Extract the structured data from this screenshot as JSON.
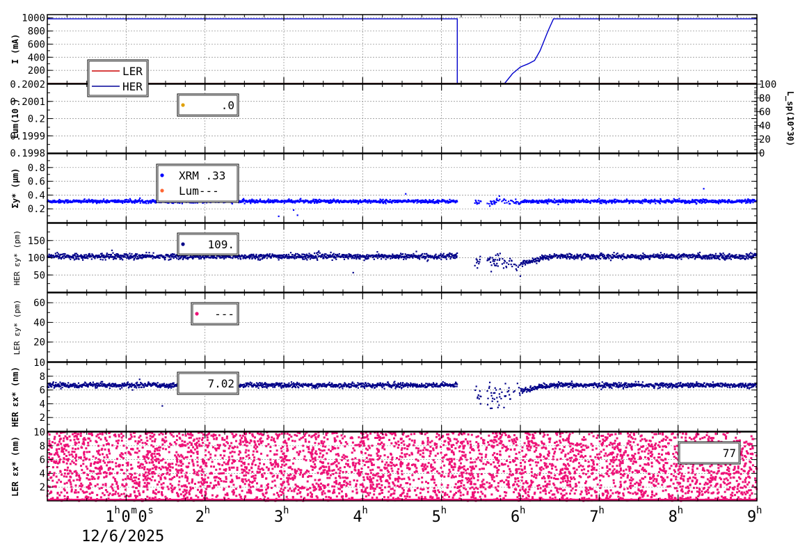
{
  "chart_data": {
    "type": "scatter",
    "x_axis": {
      "unit": "hours",
      "range": [
        0.0,
        9.0
      ],
      "tick_labels": [
        {
          "value": 1,
          "text": "1",
          "sup": "h",
          "extra": "0",
          "extra_sup": "m",
          "extra2": "0",
          "extra2_sup": "s"
        },
        {
          "value": 2,
          "text": "2",
          "sup": "h"
        },
        {
          "value": 3,
          "text": "3",
          "sup": "h"
        },
        {
          "value": 4,
          "text": "4",
          "sup": "h"
        },
        {
          "value": 5,
          "text": "5",
          "sup": "h"
        },
        {
          "value": 6,
          "text": "6",
          "sup": "h"
        },
        {
          "value": 7,
          "text": "7",
          "sup": "h"
        },
        {
          "value": 8,
          "text": "8",
          "sup": "h"
        },
        {
          "value": 9,
          "text": "9",
          "sup": "h"
        }
      ],
      "date_label": "12/6/2025"
    },
    "panels": [
      {
        "id": "current",
        "ylabel": "I (mA)",
        "ylim": [
          0,
          1050
        ],
        "yticks": [
          200,
          400,
          600,
          800,
          1000
        ],
        "grid": true,
        "legend": [
          {
            "name": "LER",
            "color": "#cc0000",
            "type": "line"
          },
          {
            "name": "HER",
            "color": "#000099",
            "type": "line"
          }
        ],
        "series": [
          {
            "name": "HER",
            "color": "#0000cc",
            "type": "line",
            "points": [
              [
                0.0,
                985
              ],
              [
                5.2,
                985
              ],
              [
                5.2,
                0
              ],
              [
                5.8,
                0
              ],
              [
                5.9,
                150
              ],
              [
                6.0,
                250
              ],
              [
                6.1,
                300
              ],
              [
                6.18,
                350
              ],
              [
                6.25,
                500
              ],
              [
                6.35,
                800
              ],
              [
                6.42,
                985
              ],
              [
                9.0,
                985
              ]
            ]
          },
          {
            "name": "LER",
            "color": "#cc0000",
            "type": "line",
            "points": [
              [
                0.0,
                0
              ],
              [
                9.0,
                0
              ]
            ]
          }
        ]
      },
      {
        "id": "lum",
        "ylabel": "Lum(10",
        "ylabel_suffix": ")",
        "ylim": [
          0.1998,
          0.2002
        ],
        "yticks": [
          0.1998,
          0.1999,
          0.2,
          0.2001,
          0.2002
        ],
        "ytick_labels": [
          "0.1998",
          "0.1999",
          "0.2",
          "0.2001",
          "0.2002"
        ],
        "y2label": "L_sp(10^30)",
        "y2ticks": [
          0,
          20,
          40,
          60,
          80,
          100
        ],
        "grid": true,
        "legend": [
          {
            "name": ".0",
            "color": "#e0a000",
            "type": "dot"
          }
        ],
        "series": []
      },
      {
        "id": "sigma",
        "ylabel": "Σy* (μm)",
        "ylim": [
          0,
          1.0
        ],
        "yticks": [
          0.2,
          0.4,
          0.6,
          0.8
        ],
        "grid": true,
        "legend": [
          {
            "name": "XRM  .33",
            "color": "#0000ff",
            "type": "dot"
          },
          {
            "name": "Lum---",
            "color": "#ff6633",
            "type": "dot"
          }
        ],
        "series": [
          {
            "name": "XRM",
            "color": "#0000ff",
            "base": 0.31,
            "noise": 0.012,
            "disturb": "sigma"
          }
        ]
      },
      {
        "id": "her_ey",
        "ylabel": "HER εy* (pm)",
        "ylim": [
          0,
          200
        ],
        "yticks": [
          50,
          100,
          150
        ],
        "grid": true,
        "legend": [
          {
            "name": "109.",
            "color": "#000088",
            "type": "dot"
          }
        ],
        "series": [
          {
            "name": "HER εy",
            "color": "#000088",
            "base": 104,
            "noise": 4,
            "disturb": "ey"
          }
        ]
      },
      {
        "id": "ler_ey",
        "ylabel": "LER εy* (pm)",
        "ylim": [
          0,
          70
        ],
        "yticks": [
          20,
          40,
          60
        ],
        "grid": true,
        "legend": [
          {
            "name": "---",
            "color": "#ee1177",
            "type": "dot"
          }
        ],
        "series": []
      },
      {
        "id": "her_ex",
        "ylabel": "HER εx* (nm)",
        "ylim": [
          0,
          10
        ],
        "yticks": [
          2,
          4,
          6,
          8,
          10
        ],
        "grid": true,
        "legend": [
          {
            "name": "7.02",
            "color": "#000088",
            "type": "none"
          }
        ],
        "series": [
          {
            "name": "HER εx",
            "color": "#000088",
            "base": 6.7,
            "noise": 0.18,
            "disturb": "ex"
          }
        ]
      },
      {
        "id": "ler_ex",
        "ylabel": "LER εx* (nm)",
        "ylim": [
          0,
          10
        ],
        "yticks": [
          2,
          4,
          6,
          8,
          10
        ],
        "grid": true,
        "legend": [
          {
            "name": "77",
            "color": "#ee1177",
            "type": "none"
          }
        ],
        "series": [
          {
            "name": "LER εx",
            "color": "#ee1177",
            "uniform": [
              0,
              10
            ],
            "count": 4200
          }
        ]
      }
    ]
  }
}
